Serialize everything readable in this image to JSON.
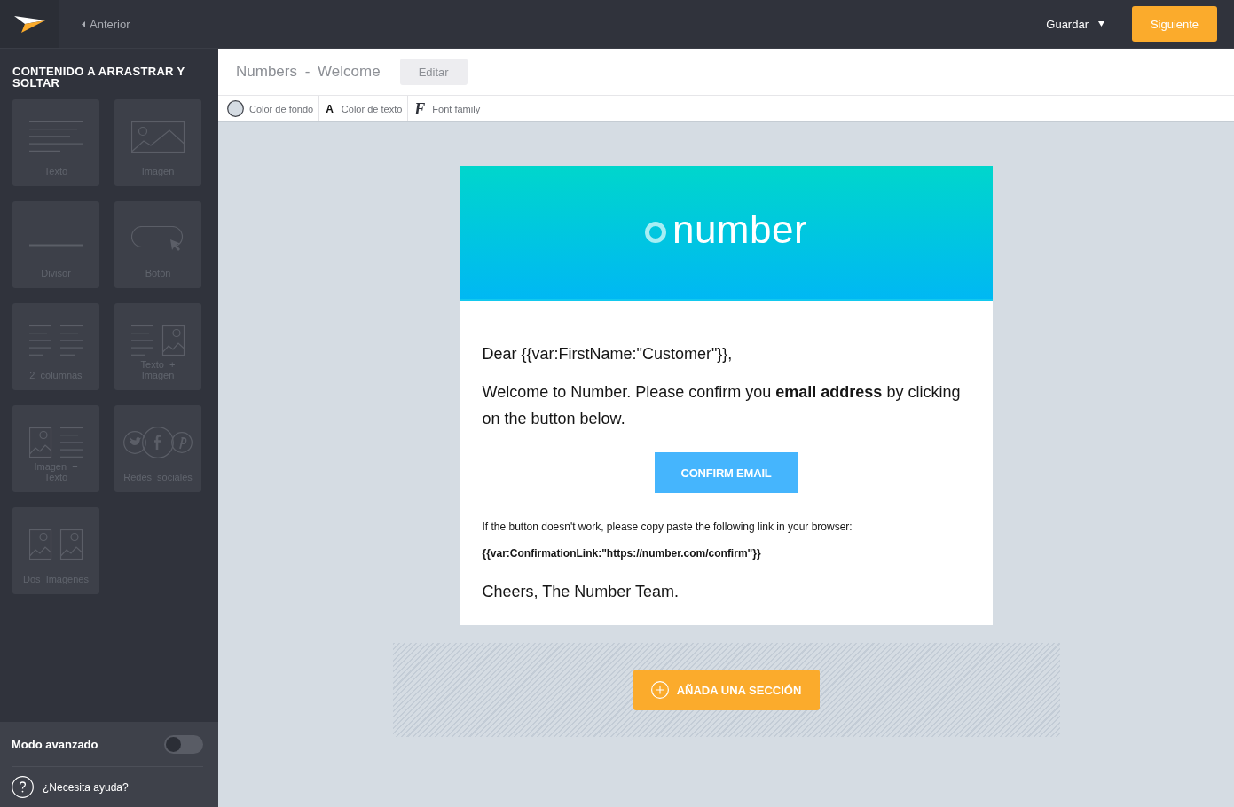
{
  "top_bar": {
    "back_link": "Anterior",
    "save_menu": "Guardar",
    "next_button": "Siguiente"
  },
  "sidebar": {
    "title": "CONTENIDO A ARRASTRAR Y SOLTAR",
    "blocks": [
      {
        "kind": "text",
        "label": "Texto"
      },
      {
        "kind": "image",
        "label": "Imagen"
      },
      {
        "kind": "divider",
        "label": "Divisor"
      },
      {
        "kind": "button",
        "label": "Botón"
      },
      {
        "kind": "two-columns",
        "label": "2 columnas"
      },
      {
        "kind": "text-image",
        "label": "Texto + Imagen"
      },
      {
        "kind": "image-text",
        "label": "Imagen + Texto"
      },
      {
        "kind": "social",
        "label": "Redes sociales"
      },
      {
        "kind": "two-images",
        "label": "Dos Imágenes"
      }
    ],
    "advanced_mode": {
      "label": "Modo avanzado",
      "on": false
    },
    "help_link": "¿Necesita ayuda?"
  },
  "editor": {
    "document_title": "Numbers - Welcome",
    "edit_button": "Editar",
    "toolbar": [
      {
        "kind": "background-color",
        "label": "Color de fondo"
      },
      {
        "kind": "text-color",
        "glyph": "A",
        "label": "Color de texto"
      },
      {
        "kind": "font-family",
        "glyph": "F",
        "label": "Font family"
      }
    ],
    "email": {
      "logo": "number",
      "greeting": "Dear {{var:FirstName:\"Customer\"}},",
      "intro": "Welcome to Number. Please confirm you **email address** by clicking on the button below.",
      "button": "CONFIRM EMAIL",
      "fallback_note": "If the button doesn't work, please copy paste the following link in your browser:",
      "link": "{{var:ConfirmationLink:\"https://number.com/confirm\"}}",
      "sign_off": "Cheers, The Number Team."
    },
    "add_section_button": "AÑADA UNA SECCIÓN"
  }
}
